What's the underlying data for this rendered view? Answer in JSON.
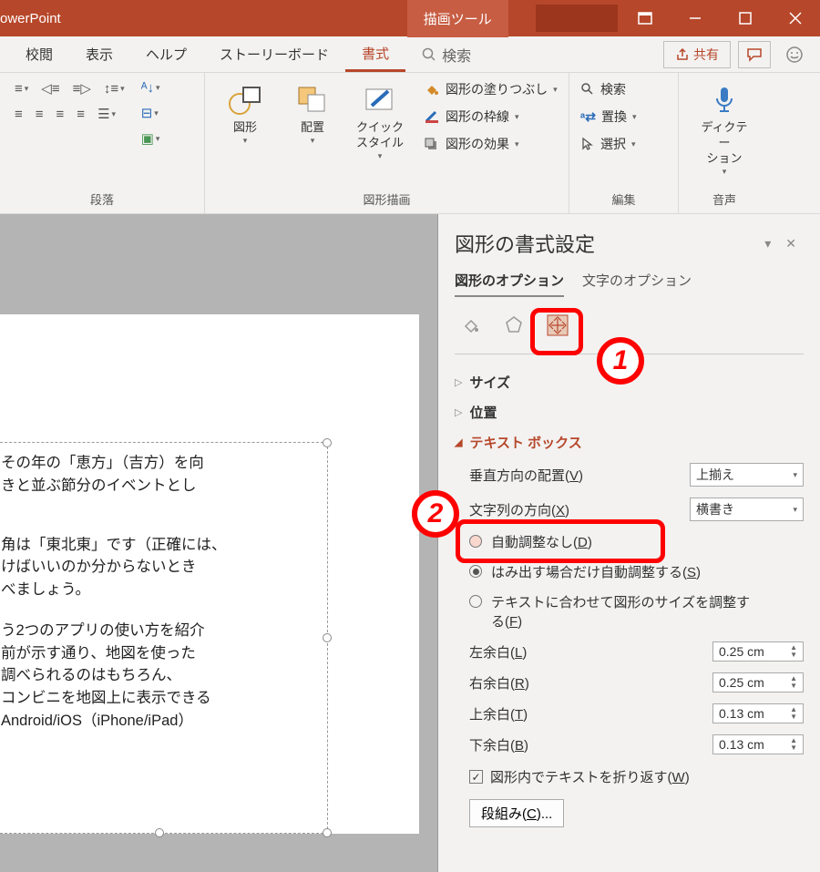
{
  "titlebar": {
    "app": "owerPoint",
    "tool_tab": "描画ツール"
  },
  "menubar": {
    "items": [
      "校閲",
      "表示",
      "ヘルプ",
      "ストーリーボード"
    ],
    "active": "書式",
    "search_label": "検索",
    "share_label": "共有"
  },
  "ribbon": {
    "groups": {
      "paragraph": "段落",
      "drawing": "図形描画",
      "editing": "編集",
      "voice": "音声"
    },
    "buttons": {
      "shape": "図形",
      "arrange": "配置",
      "quick_style": "クイック\nスタイル",
      "fill": "図形の塗りつぶし",
      "outline": "図形の枠線",
      "effects": "図形の効果",
      "find": "検索",
      "replace": "置換",
      "select": "選択",
      "dictate": "ディクテー\nション"
    }
  },
  "slide": {
    "para1": "その年の「恵方」（吉方）を向\nきと並ぶ節分のイベントとし",
    "para2": "角は「東北東」です（正確には、\nけばいいのか分からないとき\nべましょう。",
    "para3": "う2つのアプリの使い方を紹介\n前が示す通り、地図を使った\n調べられるのはもちろん、\nコンビニを地図上に表示できる\n Android/iOS（iPhone/iPad）"
  },
  "pane": {
    "title": "図形の書式設定",
    "tabs": {
      "shape": "図形のオプション",
      "text": "文字のオプション"
    },
    "sections": {
      "size": "サイズ",
      "position": "位置",
      "textbox": "テキスト ボックス"
    },
    "textbox": {
      "valign_label": "垂直方向の配置(V)",
      "valign_value": "上揃え",
      "dir_label": "文字列の方向(X)",
      "dir_value": "横書き",
      "auto_none": "自動調整なし(D)",
      "auto_shrink": "はみ出す場合だけ自動調整する(S)",
      "auto_resize": "テキストに合わせて図形のサイズを調整する(F)",
      "margin_l_label": "左余白(L)",
      "margin_l": "0.25 cm",
      "margin_r_label": "右余白(R)",
      "margin_r": "0.25 cm",
      "margin_t_label": "上余白(T)",
      "margin_t": "0.13 cm",
      "margin_b_label": "下余白(B)",
      "margin_b": "0.13 cm",
      "wrap": "図形内でテキストを折り返す(W)",
      "columns": "段組み(C)..."
    }
  },
  "annotations": {
    "one": "1",
    "two": "2"
  }
}
